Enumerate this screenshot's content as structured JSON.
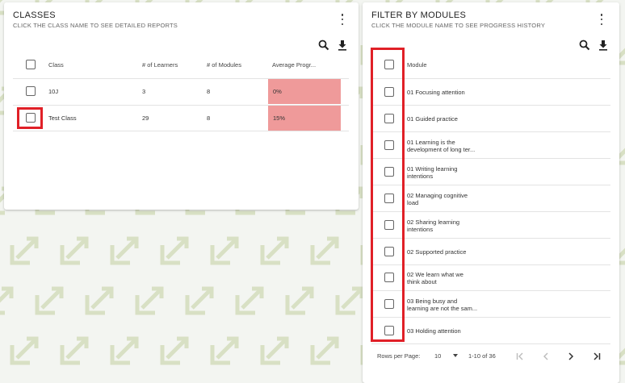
{
  "classes": {
    "title": "CLASSES",
    "subtitle": "CLICK THE CLASS NAME TO SEE DETAILED REPORTS",
    "columns": [
      "Class",
      "# of Learners",
      "# of Modules",
      "Average Progr..."
    ],
    "rows": [
      {
        "class": "10J",
        "learners": "3",
        "modules": "8",
        "progress": "0%"
      },
      {
        "class": "Test Class",
        "learners": "29",
        "modules": "8",
        "progress": "15%"
      }
    ]
  },
  "modules": {
    "title": "FILTER BY MODULES",
    "subtitle": "CLICK THE MODULE NAME TO SEE PROGRESS HISTORY",
    "column": "Module",
    "rows": [
      [
        "01 Focusing attention"
      ],
      [
        "01 Guided practice"
      ],
      [
        "01 Learning is the",
        "development of long ter..."
      ],
      [
        "01 Writing learning",
        "intentions"
      ],
      [
        "02 Managing cognitive",
        "load"
      ],
      [
        "02 Sharing learning",
        "intentions"
      ],
      [
        "02 Supported practice"
      ],
      [
        "02 We learn what we",
        "think about"
      ],
      [
        "03 Being busy and",
        "learning are not the sam..."
      ],
      [
        "03 Holding attention"
      ]
    ],
    "pager": {
      "rows_per_page_label": "Rows per Page:",
      "rows_per_page_value": "10",
      "range": "1-10 of 36"
    }
  },
  "colors": {
    "progress_fill": "#ef9a9a",
    "highlight": "#e02027",
    "pattern": "#d8e0c4"
  }
}
